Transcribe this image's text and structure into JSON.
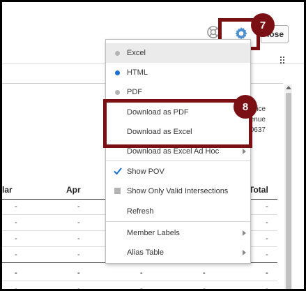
{
  "toolbar": {
    "close_label": "lose",
    "help_icon": "lifebuoy-icon",
    "gear_icon": "gear-icon",
    "gear_color": "#4a8fd4"
  },
  "badges": {
    "step7": "7",
    "step8": "8",
    "color": "#7a0f14"
  },
  "address": {
    "line1": "ice",
    "line2": "enue",
    "line3": "0637"
  },
  "table": {
    "headers": {
      "c1": "lar",
      "c2": "Apr",
      "c3": "Total"
    },
    "dash": "-"
  },
  "menu": {
    "items": [
      {
        "label": "Excel",
        "marker": "radio-off"
      },
      {
        "label": "HTML",
        "marker": "radio-on"
      },
      {
        "label": "PDF",
        "marker": "radio-off"
      },
      {
        "label": "Download as PDF"
      },
      {
        "label": "Download as Excel"
      },
      {
        "label": "Download as Excel Ad Hoc",
        "submenu": true
      },
      {
        "label": "Show POV",
        "marker": "check"
      },
      {
        "label": "Show Only Valid Intersections",
        "marker": "square"
      },
      {
        "label": "Refresh"
      },
      {
        "label": "Member Labels",
        "submenu": true
      },
      {
        "label": "Alias Table",
        "submenu": true
      }
    ],
    "accent": "#1a6fcf"
  }
}
